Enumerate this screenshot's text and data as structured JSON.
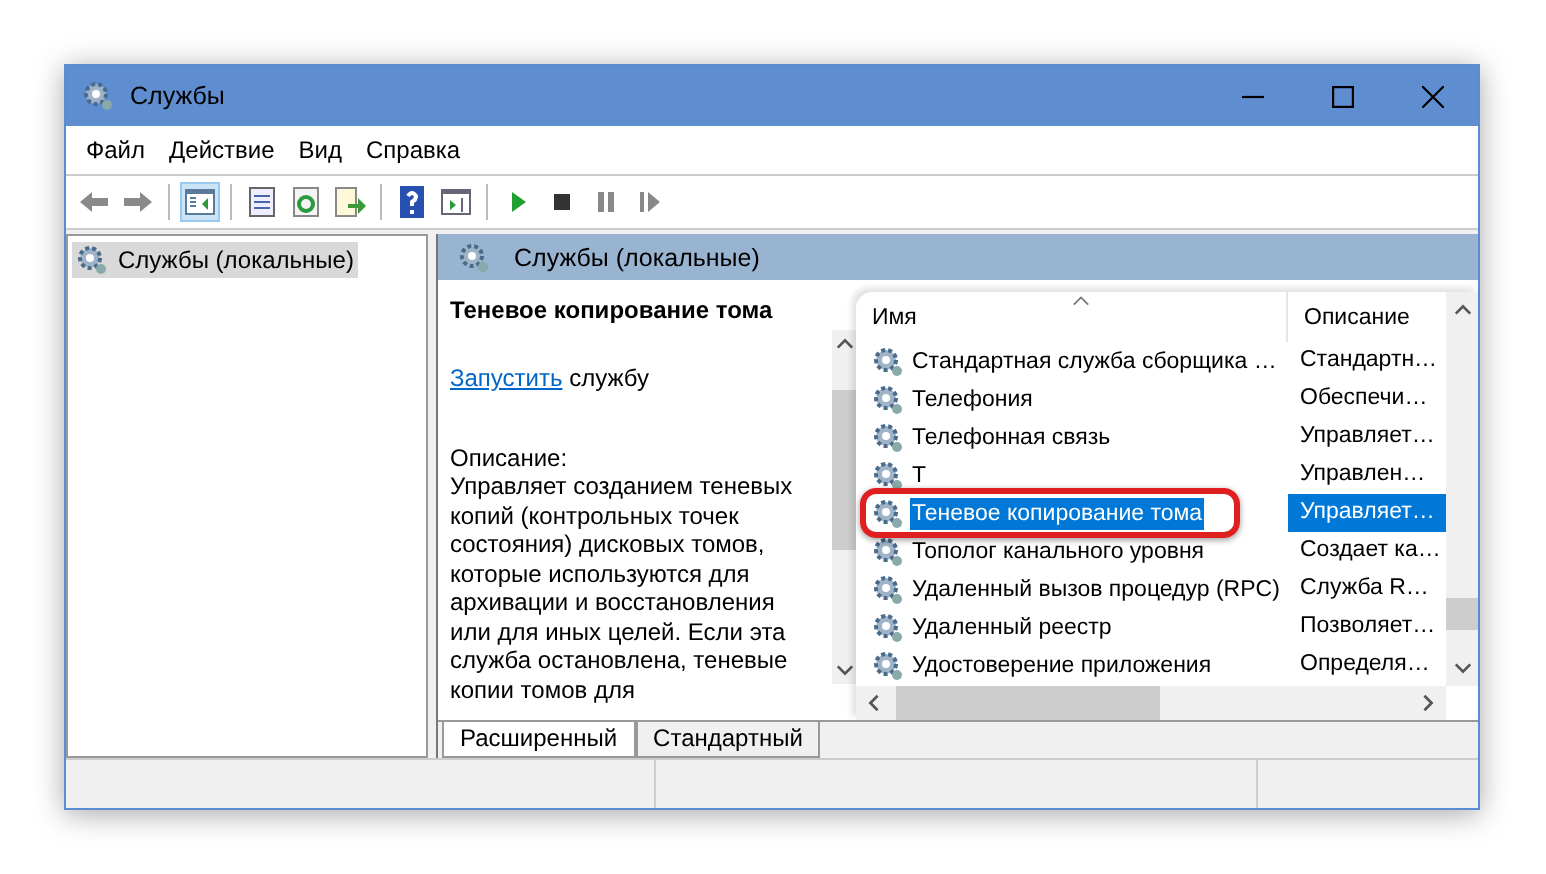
{
  "window": {
    "title": "Службы"
  },
  "menu": [
    "Файл",
    "Действие",
    "Вид",
    "Справка"
  ],
  "toolbar": [
    {
      "kind": "back",
      "selected": false
    },
    {
      "kind": "forward",
      "selected": false
    },
    {
      "kind": "tree",
      "selected": true
    },
    {
      "kind": "properties",
      "selected": false
    },
    {
      "kind": "refresh",
      "selected": false
    },
    {
      "kind": "export",
      "selected": false
    },
    {
      "kind": "help",
      "selected": false
    },
    {
      "kind": "view",
      "selected": false
    },
    {
      "kind": "play",
      "selected": false
    },
    {
      "kind": "stop",
      "selected": false
    },
    {
      "kind": "pause",
      "selected": false
    },
    {
      "kind": "resume",
      "selected": false
    }
  ],
  "tree": [
    {
      "label": "Службы (локальные)",
      "selected": true
    }
  ],
  "pane_title": "Службы (локальные)",
  "details": {
    "title": "Теневое копирование тома",
    "link": "Запустить",
    "link_rest": " службу",
    "description_label": "Описание:",
    "description": "Управляет созданием теневых\nкопий (контрольных точек\nсостояния) дисковых томов,\nкоторые используются для\nархивации и восстановления\nили для иных целей. Если эта\nслужба остановлена, теневые\nкопии томов для"
  },
  "list": {
    "columns": [
      "Имя",
      "Описание"
    ],
    "rows": [
      {
        "name": "Стандартная служба сборщика …",
        "description": "Стандартн…",
        "selected": false,
        "highlighted": false
      },
      {
        "name": "Телефония",
        "description": "Обеспечи…",
        "selected": false,
        "highlighted": false
      },
      {
        "name": "Телефонная связь",
        "description": "Управляет…",
        "selected": false,
        "highlighted": false
      },
      {
        "name": "Т",
        "description": "Управлен…",
        "selected": false,
        "highlighted": false
      },
      {
        "name": "Теневое копирование тома",
        "description": "Управляет…",
        "selected": true,
        "highlighted": true
      },
      {
        "name": "Тополог канального уровня",
        "description": "Создает ка…",
        "selected": false,
        "highlighted": false
      },
      {
        "name": "Удаленный вызов процедур (RPC)",
        "description": "Служба R…",
        "selected": false,
        "highlighted": false
      },
      {
        "name": "Удаленный реестр",
        "description": "Позволяет…",
        "selected": false,
        "highlighted": false
      },
      {
        "name": "Удостоверение приложения",
        "description": "Определя…",
        "selected": false,
        "highlighted": false
      }
    ]
  },
  "tabs": [
    {
      "label": "Расширенный",
      "selected": true
    },
    {
      "label": "Стандартный",
      "selected": false
    }
  ]
}
